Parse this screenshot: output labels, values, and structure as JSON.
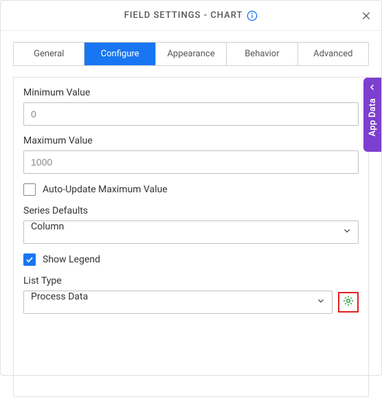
{
  "header": {
    "title": "FIELD SETTINGS - CHART"
  },
  "tabs": {
    "items": [
      {
        "label": "General"
      },
      {
        "label": "Configure"
      },
      {
        "label": "Appearance"
      },
      {
        "label": "Behavior"
      },
      {
        "label": "Advanced"
      }
    ],
    "active_index": 1
  },
  "form": {
    "min_label": "Minimum Value",
    "min_value": "0",
    "max_label": "Maximum Value",
    "max_value": "1000",
    "auto_update": {
      "label": "Auto-Update Maximum Value",
      "checked": false
    },
    "series_defaults": {
      "label": "Series Defaults",
      "value": "Column"
    },
    "show_legend": {
      "label": "Show Legend",
      "checked": true
    },
    "list_type": {
      "label": "List Type",
      "value": "Process Data"
    }
  },
  "side_panel": {
    "label": "App Data"
  }
}
